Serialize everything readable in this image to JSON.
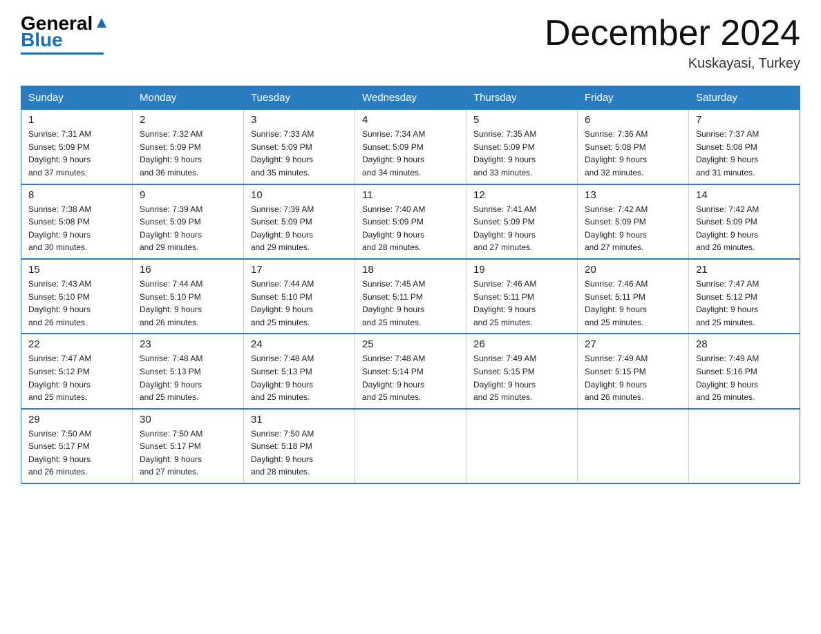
{
  "header": {
    "logo_general": "General",
    "logo_blue": "Blue",
    "month_title": "December 2024",
    "location": "Kuskayasi, Turkey"
  },
  "days_of_week": [
    "Sunday",
    "Monday",
    "Tuesday",
    "Wednesday",
    "Thursday",
    "Friday",
    "Saturday"
  ],
  "weeks": [
    [
      {
        "day": "1",
        "sunrise": "7:31 AM",
        "sunset": "5:09 PM",
        "daylight": "9 hours and 37 minutes."
      },
      {
        "day": "2",
        "sunrise": "7:32 AM",
        "sunset": "5:09 PM",
        "daylight": "9 hours and 36 minutes."
      },
      {
        "day": "3",
        "sunrise": "7:33 AM",
        "sunset": "5:09 PM",
        "daylight": "9 hours and 35 minutes."
      },
      {
        "day": "4",
        "sunrise": "7:34 AM",
        "sunset": "5:09 PM",
        "daylight": "9 hours and 34 minutes."
      },
      {
        "day": "5",
        "sunrise": "7:35 AM",
        "sunset": "5:09 PM",
        "daylight": "9 hours and 33 minutes."
      },
      {
        "day": "6",
        "sunrise": "7:36 AM",
        "sunset": "5:08 PM",
        "daylight": "9 hours and 32 minutes."
      },
      {
        "day": "7",
        "sunrise": "7:37 AM",
        "sunset": "5:08 PM",
        "daylight": "9 hours and 31 minutes."
      }
    ],
    [
      {
        "day": "8",
        "sunrise": "7:38 AM",
        "sunset": "5:08 PM",
        "daylight": "9 hours and 30 minutes."
      },
      {
        "day": "9",
        "sunrise": "7:39 AM",
        "sunset": "5:09 PM",
        "daylight": "9 hours and 29 minutes."
      },
      {
        "day": "10",
        "sunrise": "7:39 AM",
        "sunset": "5:09 PM",
        "daylight": "9 hours and 29 minutes."
      },
      {
        "day": "11",
        "sunrise": "7:40 AM",
        "sunset": "5:09 PM",
        "daylight": "9 hours and 28 minutes."
      },
      {
        "day": "12",
        "sunrise": "7:41 AM",
        "sunset": "5:09 PM",
        "daylight": "9 hours and 27 minutes."
      },
      {
        "day": "13",
        "sunrise": "7:42 AM",
        "sunset": "5:09 PM",
        "daylight": "9 hours and 27 minutes."
      },
      {
        "day": "14",
        "sunrise": "7:42 AM",
        "sunset": "5:09 PM",
        "daylight": "9 hours and 26 minutes."
      }
    ],
    [
      {
        "day": "15",
        "sunrise": "7:43 AM",
        "sunset": "5:10 PM",
        "daylight": "9 hours and 26 minutes."
      },
      {
        "day": "16",
        "sunrise": "7:44 AM",
        "sunset": "5:10 PM",
        "daylight": "9 hours and 26 minutes."
      },
      {
        "day": "17",
        "sunrise": "7:44 AM",
        "sunset": "5:10 PM",
        "daylight": "9 hours and 25 minutes."
      },
      {
        "day": "18",
        "sunrise": "7:45 AM",
        "sunset": "5:11 PM",
        "daylight": "9 hours and 25 minutes."
      },
      {
        "day": "19",
        "sunrise": "7:46 AM",
        "sunset": "5:11 PM",
        "daylight": "9 hours and 25 minutes."
      },
      {
        "day": "20",
        "sunrise": "7:46 AM",
        "sunset": "5:11 PM",
        "daylight": "9 hours and 25 minutes."
      },
      {
        "day": "21",
        "sunrise": "7:47 AM",
        "sunset": "5:12 PM",
        "daylight": "9 hours and 25 minutes."
      }
    ],
    [
      {
        "day": "22",
        "sunrise": "7:47 AM",
        "sunset": "5:12 PM",
        "daylight": "9 hours and 25 minutes."
      },
      {
        "day": "23",
        "sunrise": "7:48 AM",
        "sunset": "5:13 PM",
        "daylight": "9 hours and 25 minutes."
      },
      {
        "day": "24",
        "sunrise": "7:48 AM",
        "sunset": "5:13 PM",
        "daylight": "9 hours and 25 minutes."
      },
      {
        "day": "25",
        "sunrise": "7:48 AM",
        "sunset": "5:14 PM",
        "daylight": "9 hours and 25 minutes."
      },
      {
        "day": "26",
        "sunrise": "7:49 AM",
        "sunset": "5:15 PM",
        "daylight": "9 hours and 25 minutes."
      },
      {
        "day": "27",
        "sunrise": "7:49 AM",
        "sunset": "5:15 PM",
        "daylight": "9 hours and 26 minutes."
      },
      {
        "day": "28",
        "sunrise": "7:49 AM",
        "sunset": "5:16 PM",
        "daylight": "9 hours and 26 minutes."
      }
    ],
    [
      {
        "day": "29",
        "sunrise": "7:50 AM",
        "sunset": "5:17 PM",
        "daylight": "9 hours and 26 minutes."
      },
      {
        "day": "30",
        "sunrise": "7:50 AM",
        "sunset": "5:17 PM",
        "daylight": "9 hours and 27 minutes."
      },
      {
        "day": "31",
        "sunrise": "7:50 AM",
        "sunset": "5:18 PM",
        "daylight": "9 hours and 28 minutes."
      },
      null,
      null,
      null,
      null
    ]
  ],
  "labels": {
    "sunrise": "Sunrise:",
    "sunset": "Sunset:",
    "daylight": "Daylight:"
  }
}
